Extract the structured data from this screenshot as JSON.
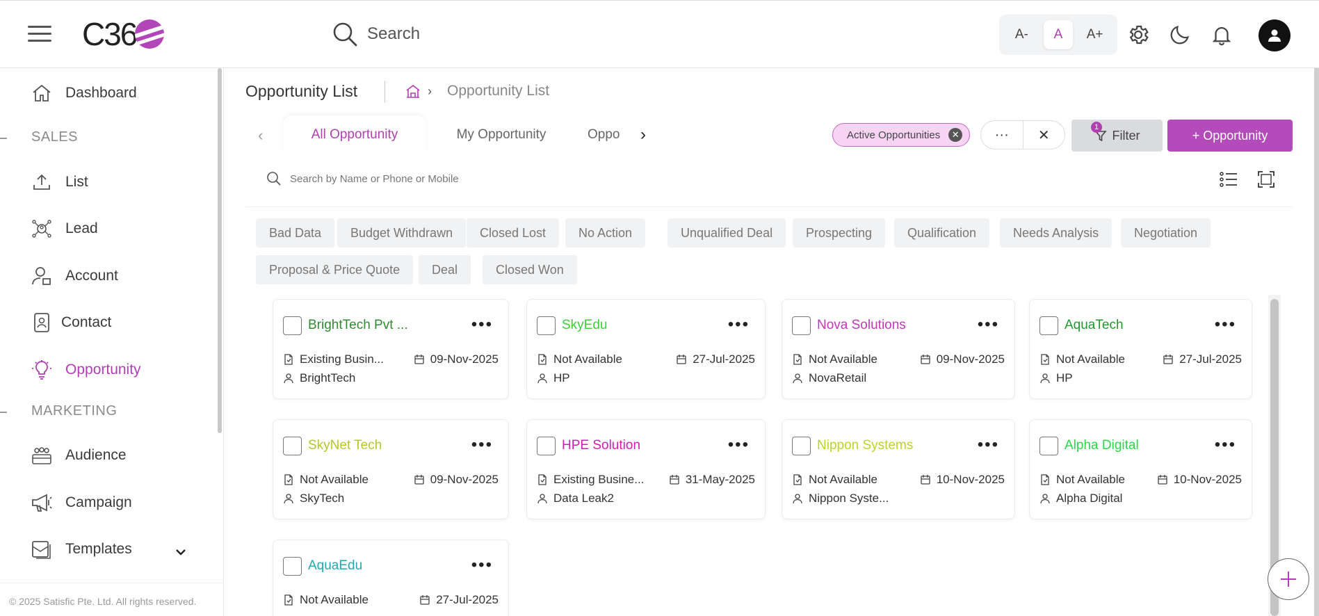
{
  "header": {
    "logo_text": "C36",
    "search_placeholder": "Search",
    "font_sizes": [
      "A-",
      "A",
      "A+"
    ],
    "icons": [
      "menu-icon",
      "search-icon",
      "gear-icon",
      "moon-icon",
      "bell-icon",
      "user-icon"
    ]
  },
  "sidebar": {
    "items": [
      {
        "label": "Dashboard",
        "icon": "home-icon"
      },
      {
        "section": "SALES"
      },
      {
        "label": "List",
        "icon": "upload-icon"
      },
      {
        "label": "Lead",
        "icon": "lead-icon"
      },
      {
        "label": "Account",
        "icon": "account-icon"
      },
      {
        "label": "Contact",
        "icon": "contact-icon"
      },
      {
        "label": "Opportunity",
        "icon": "bulb-icon",
        "active": true
      },
      {
        "section": "MARKETING"
      },
      {
        "label": "Audience",
        "icon": "audience-icon"
      },
      {
        "label": "Campaign",
        "icon": "megaphone-icon"
      },
      {
        "label": "Templates",
        "icon": "template-icon"
      }
    ],
    "footer": "© 2025 Satisfic Pte. Ltd. All rights reserved."
  },
  "page": {
    "title": "Opportunity List",
    "breadcrumb_current": "Opportunity List"
  },
  "tabs": [
    "All Opportunity",
    "My Opportunity",
    "Oppo"
  ],
  "active_filter": "Active Opportunities",
  "more_label": "···",
  "close_label": "✕",
  "filter_label": "Filter",
  "filter_count": "1",
  "add_label": "+ Opportunity",
  "list_search_placeholder": "Search by Name or Phone or Mobile",
  "stage_chips": [
    "Bad Data",
    "Budget Withdrawn",
    "Closed Lost",
    "No Action",
    "Unqualified Deal",
    "Prospecting",
    "Qualification",
    "Needs Analysis",
    "Negotiation",
    "Proposal & Price Quote",
    "Deal",
    "Closed Won"
  ],
  "cards": [
    {
      "title": "BrightTech Pvt ...",
      "color": "#2e8b2e",
      "type": "Existing Busin...",
      "date": "09-Nov-2025",
      "account": "BrightTech"
    },
    {
      "title": "SkyEdu",
      "color": "#3ccf3c",
      "type": "Not Available",
      "date": "27-Jul-2025",
      "account": "HP"
    },
    {
      "title": "Nova Solutions",
      "color": "#c236b8",
      "type": "Not Available",
      "date": "09-Nov-2025",
      "account": "NovaRetail"
    },
    {
      "title": "AquaTech",
      "color": "#1f9a2e",
      "type": "Not Available",
      "date": "27-Jul-2025",
      "account": "HP"
    },
    {
      "title": "SkyNet Tech",
      "color": "#b5c72a",
      "type": "Not Available",
      "date": "09-Nov-2025",
      "account": "SkyTech"
    },
    {
      "title": "HPE Solution",
      "color": "#d61ab8",
      "type": "Existing Busine...",
      "date": "31-May-2025",
      "account": "Data Leak2"
    },
    {
      "title": "Nippon Systems",
      "color": "#bcd32a",
      "type": "Not Available",
      "date": "10-Nov-2025",
      "account": "Nippon Syste..."
    },
    {
      "title": "Alpha Digital",
      "color": "#2ed44a",
      "type": "Not Available",
      "date": "10-Nov-2025",
      "account": "Alpha Digital"
    },
    {
      "title": "AquaEdu",
      "color": "#22a7b5",
      "type": "Not Available",
      "date": "27-Jul-2025",
      "account": ""
    }
  ],
  "accent_color": "#b03fb2"
}
